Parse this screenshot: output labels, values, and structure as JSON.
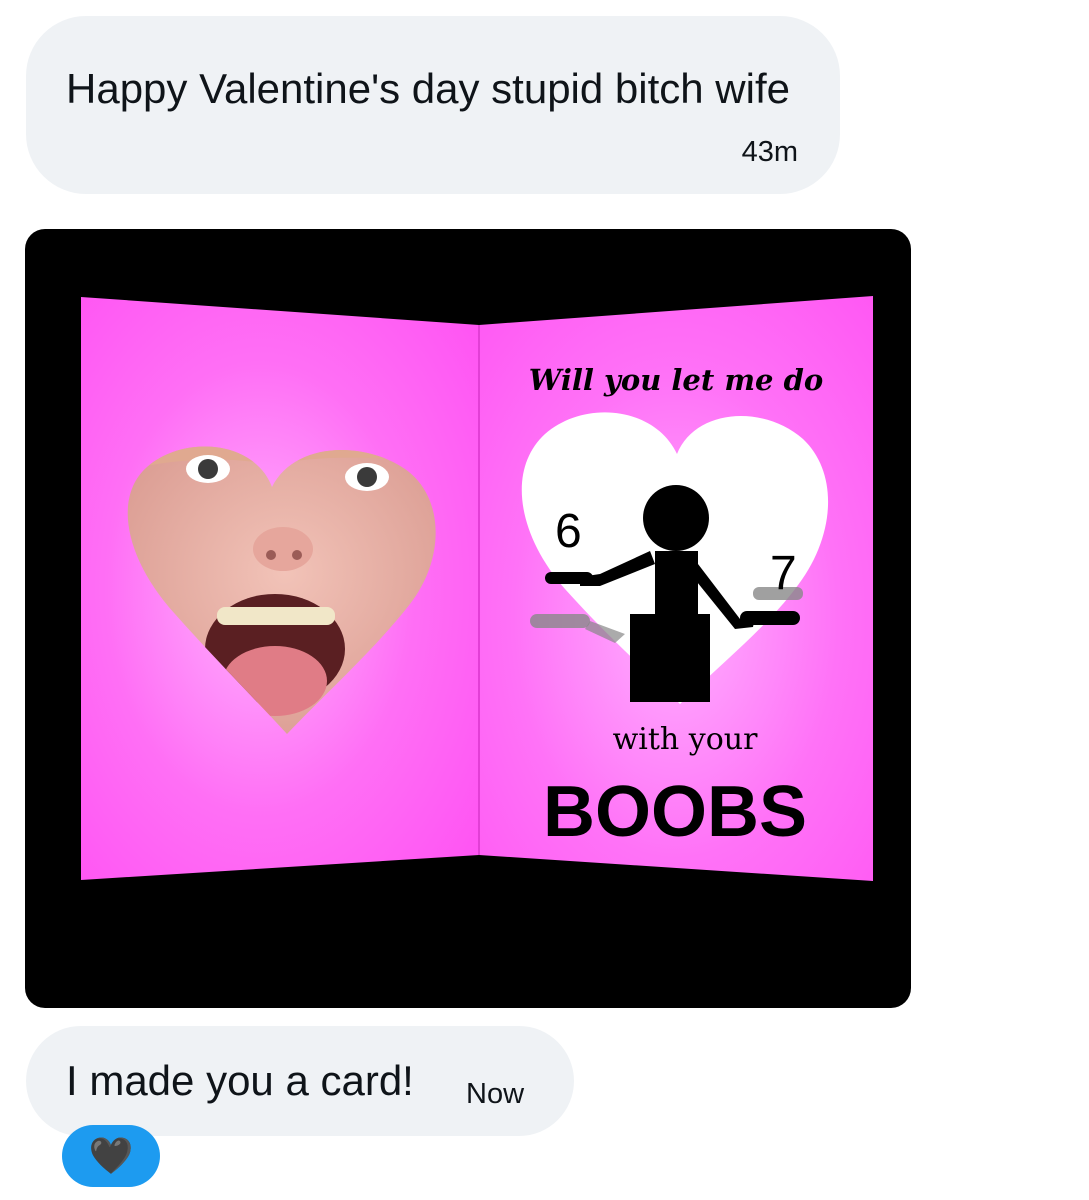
{
  "messages": [
    {
      "text": "Happy Valentine's day stupid bitch wife",
      "time": "43m"
    },
    {
      "text": "I made you a card!",
      "time": "Now"
    }
  ],
  "card": {
    "line1": "Will you let me do",
    "number_left": "6",
    "number_right": "7",
    "line2": "with your",
    "line3": "BOOBS",
    "background_color": "#ff5ef7",
    "heart_color": "#ffffff"
  },
  "reaction": {
    "emoji": "🖤",
    "color": "#1d9bf0"
  },
  "colors": {
    "bubble_background": "#eff2f5",
    "text": "#0f1419"
  }
}
